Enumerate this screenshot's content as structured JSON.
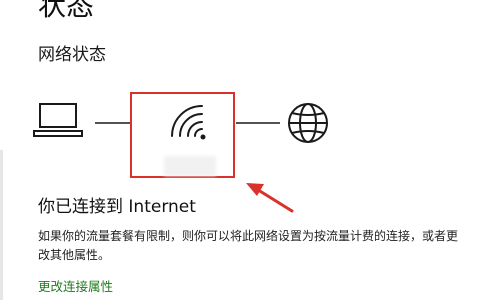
{
  "page": {
    "title": "状态",
    "section_heading": "网络状态"
  },
  "diagram": {
    "nodes": [
      "laptop-icon",
      "wifi-icon",
      "globe-icon"
    ],
    "network_name": "",
    "highlight_color": "#d9322b",
    "icon_color": "#1a1a1a"
  },
  "status": {
    "connected_text": "你已连接到 Internet",
    "description": "如果你的流量套餐有限制，则你可以将此网络设置为按流量计费的连接，或者更改其他属性。"
  },
  "links": {
    "change_properties": "更改连接属性",
    "link_color": "#1f7a1f"
  }
}
